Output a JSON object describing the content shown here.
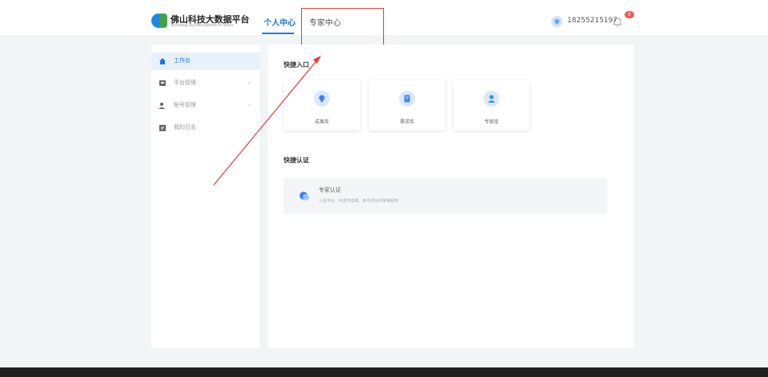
{
  "header": {
    "logo_title": "佛山科技大数据平台",
    "logo_subtitle": "Technology big data platform of Foshan",
    "tabs": [
      {
        "label": "个人中心",
        "active": true
      },
      {
        "label": "专家中心",
        "active": false
      }
    ],
    "user_phone": "18255215197",
    "notification_count": "0"
  },
  "sidebar": {
    "items": [
      {
        "label": "工作台",
        "icon": "home-icon",
        "active": true
      },
      {
        "label": "平台管理",
        "icon": "platform-icon",
        "has_submenu": true
      },
      {
        "label": "账号管理",
        "icon": "account-icon",
        "has_submenu": true
      },
      {
        "label": "我的日志",
        "icon": "log-icon"
      }
    ]
  },
  "main": {
    "quick_entry_title": "快捷入口",
    "cards": [
      {
        "label": "成果库",
        "icon": "lightbulb-icon",
        "color": "#3b82f6"
      },
      {
        "label": "需求库",
        "icon": "document-icon",
        "color": "#3b82f6"
      },
      {
        "label": "专家库",
        "icon": "expert-icon",
        "color": "#3b82f6"
      }
    ],
    "quick_cert_title": "快捷认证",
    "cert": {
      "title": "专家认证",
      "description": "入驻平台，可发布成果，参与项目评审等服务",
      "icon": "expert-cert-icon"
    }
  },
  "colors": {
    "accent": "#1a73e8",
    "annotation": "#e53935",
    "badge": "#f05a5a"
  }
}
